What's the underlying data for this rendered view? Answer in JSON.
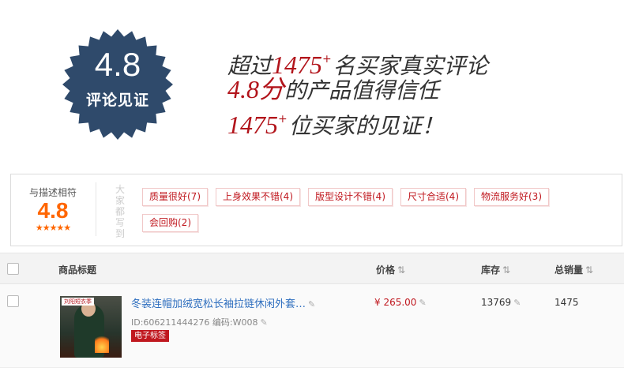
{
  "hero": {
    "badge_score": "4.8",
    "badge_caption": "评论见证",
    "line1_pre": "超过",
    "line1_num": "1475",
    "line1_post": "名买家真实评论",
    "line2_num": "4.8分",
    "line2_post": "的产品值得信任",
    "line3_num": "1475",
    "line3_post": "位买家的见证！",
    "sup": "+",
    "badge_color": "#2f4a6b",
    "accent_color": "#b2141b"
  },
  "rating": {
    "label": "与描述相符",
    "score": "4.8",
    "stars": "★★★★★",
    "everyone_says": "大家都写到",
    "tags": [
      "质量很好(7)",
      "上身效果不错(4)",
      "版型设计不错(4)",
      "尺寸合适(4)",
      "物流服务好(3)",
      "会回购(2)"
    ]
  },
  "table": {
    "headers": {
      "title": "商品标题",
      "price": "价格",
      "stock": "库存",
      "sales": "总销量"
    },
    "sort_icon": "⇅",
    "row": {
      "title": "冬装连帽加绒宽松长袖拉链休闲外套…",
      "id_text": "ID:606211444276 编码:W008",
      "etag": "电子标签",
      "thumb_banner": "刘阳短衣季",
      "price": "¥ 265.00",
      "stock": "13769",
      "sales": "1475",
      "edit_icon": "✎"
    }
  }
}
